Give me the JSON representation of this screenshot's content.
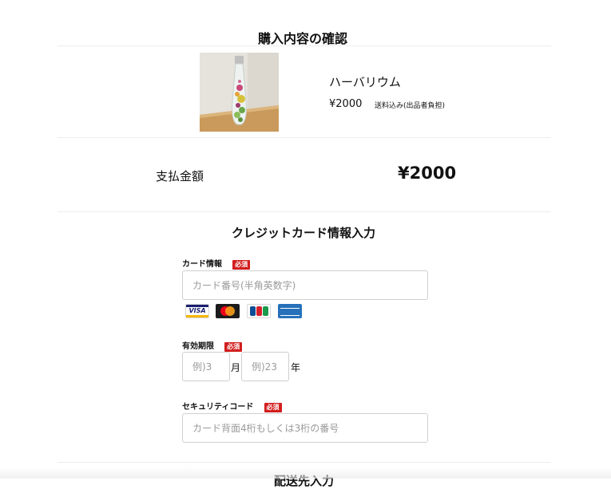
{
  "confirm_section": {
    "title": "購入内容の確認",
    "product": {
      "name": "ハーバリウム",
      "price": "¥2000",
      "shipping_note": "送料込み(出品者負担)"
    }
  },
  "payment": {
    "label": "支払金額",
    "amount": "¥2000"
  },
  "card_form": {
    "title": "クレジットカード情報入力",
    "required_badge": "必須",
    "card_info": {
      "label": "カード情報",
      "placeholder": "カード番号(半角英数字)",
      "brands": [
        "VISA",
        "Mastercard",
        "JCB",
        "American Express"
      ]
    },
    "expiry": {
      "label": "有効期限",
      "month_placeholder": "例)3",
      "month_unit": "月",
      "year_placeholder": "例)23",
      "year_unit": "年"
    },
    "security": {
      "label": "セキュリティコード",
      "placeholder": "カード背面4桁もしくは3桁の番号"
    }
  },
  "shipping_section": {
    "title": "配送先入力"
  }
}
